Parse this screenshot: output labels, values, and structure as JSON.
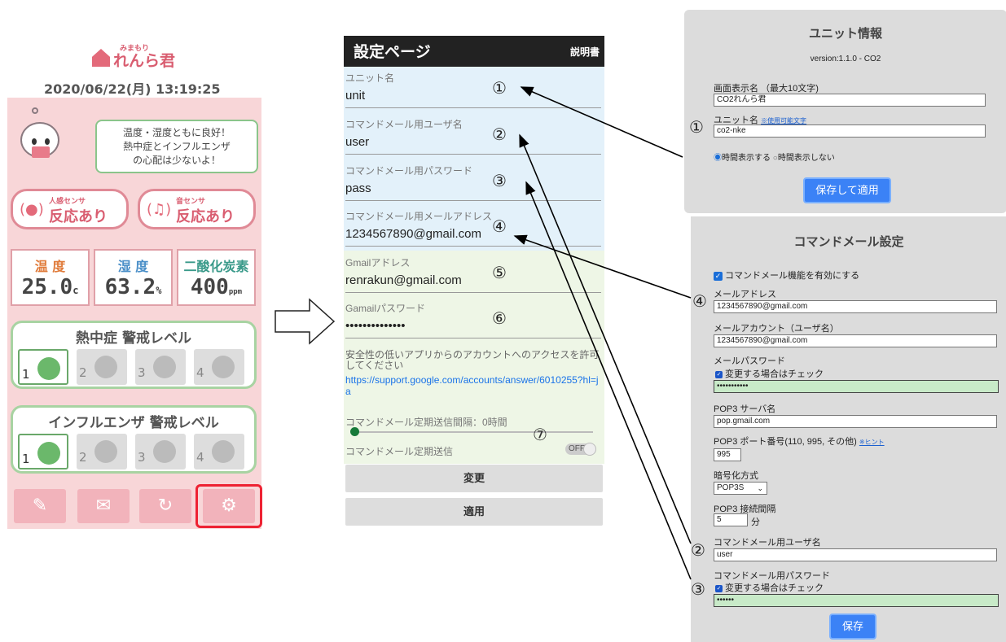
{
  "left_app": {
    "logo_sub": "みまもり",
    "logo_main": "れんら君",
    "datetime": "2020/06/22(月) 13:19:25",
    "bubble": [
      "温度・湿度ともに良好！",
      "熱中症とインフルエンザ",
      "の心配は少ないよ！"
    ],
    "sensors": [
      {
        "small": "人感センサ",
        "big": "反応あり",
        "icon": "person-icon"
      },
      {
        "small": "音センサ",
        "big": "反応あり",
        "icon": "music-note-icon"
      }
    ],
    "measurements": [
      {
        "label": "温 度",
        "value": "25.0",
        "unit": "c",
        "color": "#e07b3a"
      },
      {
        "label": "湿 度",
        "value": "63.2",
        "unit": "%",
        "color": "#4a8fc8"
      },
      {
        "label": "二酸化炭素",
        "value": "400",
        "unit": "ppm",
        "color": "#3a9a8a"
      }
    ],
    "heat_title": "熱中症 警戒レベル",
    "flu_title": "インフルエンザ 警戒レベル",
    "level_prefix": "レベル",
    "levels": [
      "1",
      "2",
      "3",
      "4"
    ],
    "toolbar": [
      "edit-icon",
      "mail-icon",
      "refresh-icon",
      "settings-icon"
    ]
  },
  "mid_app": {
    "title": "設定ページ",
    "manual": "説明書",
    "fields": [
      {
        "label": "ユニット名",
        "value": "unit",
        "num": "①"
      },
      {
        "label": "コマンドメール用ユーザ名",
        "value": "user",
        "num": "②"
      },
      {
        "label": "コマンドメール用パスワード",
        "value": "pass",
        "num": "③"
      },
      {
        "label": "コマンドメール用メールアドレス",
        "value": "1234567890@gmail.com",
        "num": "④"
      },
      {
        "label": "Gmailアドレス",
        "value": "renrakun@gmail.com",
        "num": "⑤"
      },
      {
        "label": "Gamailパスワード",
        "value": "••••••••••••••",
        "num": "⑥"
      }
    ],
    "note": "安全性の低いアプリからのアカウントへのアクセスを許可してください",
    "link": "https://support.google.com/accounts/answer/6010255?hl=ja",
    "interval_label": "コマンドメール定期送信間隔：0時間",
    "num7": "⑦",
    "periodic_label": "コマンドメール定期送信",
    "toggle": "OFF",
    "change_btn": "変更",
    "apply_btn": "適用"
  },
  "unit_panel": {
    "title": "ユニット情報",
    "version": "version:1.1.0 - CO2",
    "display_name_label": "画面表示名 （最大10文字)",
    "display_name_value": "CO2れんら君",
    "unit_name_label": "ユニット名",
    "unit_name_link": "※使用可能文字",
    "unit_name_value": "co2-nke",
    "radio_on": "時間表示する",
    "radio_off": "時間表示しない",
    "save_apply": "保存して適用",
    "num": "①"
  },
  "cmd_panel": {
    "title": "コマンドメール設定",
    "enable_label": "コマンドメール機能を有効にする",
    "mail_label": "メールアドレス",
    "mail_value": "1234567890@gmail.com",
    "account_label": "メールアカウント（ユーザ名）",
    "account_value": "1234567890@gmail.com",
    "pw_label": "メールパスワード",
    "change_check": "変更する場合はチェック",
    "pw_value": "•••••••••••",
    "pop3_label": "POP3 サーバ名",
    "pop3_value": "pop.gmail.com",
    "port_label": "POP3 ポート番号(110, 995, その他)",
    "port_hint": "※ヒント",
    "port_value": "995",
    "enc_label": "暗号化方式",
    "enc_value": "POP3S",
    "interval_label": "POP3 接続間隔",
    "interval_value": "5",
    "interval_unit": "分",
    "user_label": "コマンドメール用ユーザ名",
    "user_value": "user",
    "cpw_label": "コマンドメール用パスワード",
    "cpw_value": "••••••",
    "save": "保存",
    "nums": [
      "④",
      "②",
      "③"
    ]
  },
  "colors": {
    "accent": "#d95d70",
    "pink_bg": "#f8d6d8",
    "blue_btn": "#3b82f6",
    "highlight": "#e22233"
  }
}
